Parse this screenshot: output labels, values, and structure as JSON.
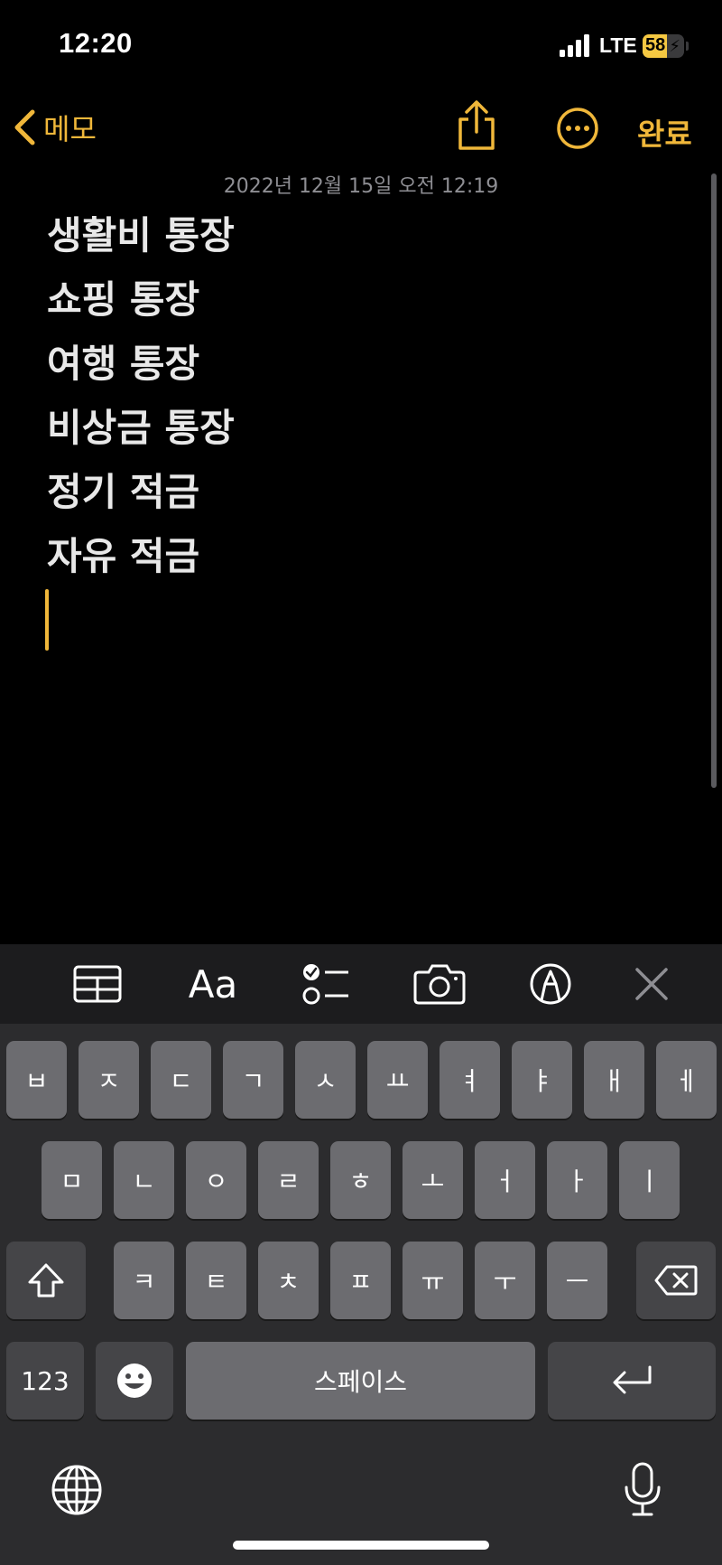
{
  "status_bar": {
    "time": "12:20",
    "network": "LTE",
    "battery": "58",
    "battery_fraction": 0.58
  },
  "nav": {
    "back_label": "메모",
    "done_label": "완료"
  },
  "note": {
    "date": "2022년 12월 15일 오전 12:19",
    "lines": [
      "생활비 통장",
      "쇼핑 통장",
      "여행 통장",
      "비상금 통장",
      "정기 적금",
      "자유 적금"
    ]
  },
  "toolbar": {
    "format_label": "Aa"
  },
  "keyboard": {
    "row1": [
      "ㅂ",
      "ㅈ",
      "ㄷ",
      "ㄱ",
      "ㅅ",
      "ㅛ",
      "ㅕ",
      "ㅑ",
      "ㅐ",
      "ㅔ"
    ],
    "row2": [
      "ㅁ",
      "ㄴ",
      "ㅇ",
      "ㄹ",
      "ㅎ",
      "ㅗ",
      "ㅓ",
      "ㅏ",
      "ㅣ"
    ],
    "row3": [
      "ㅋ",
      "ㅌ",
      "ㅊ",
      "ㅍ",
      "ㅠ",
      "ㅜ",
      "ㅡ"
    ],
    "numbers_label": "123",
    "space_label": "스페이스"
  },
  "colors": {
    "accent": "#f0b73a",
    "background": "#000000",
    "key": "#6c6c70",
    "key_dark": "#454548"
  }
}
